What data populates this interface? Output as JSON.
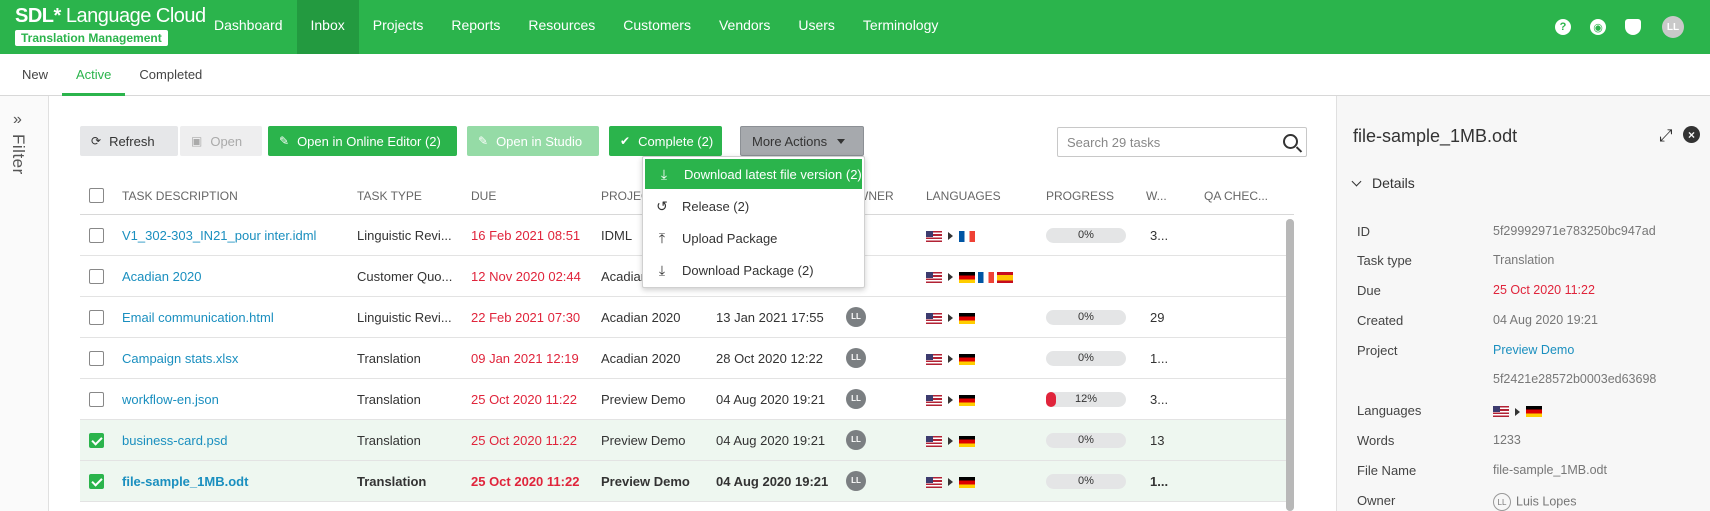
{
  "app": {
    "logo_brand": "SDL",
    "logo_star": "*",
    "logo_product": " Language Cloud",
    "logo_sub": "Translation Management"
  },
  "nav": {
    "items": [
      "Dashboard",
      "Inbox",
      "Projects",
      "Reports",
      "Resources",
      "Customers",
      "Vendors",
      "Users",
      "Terminology"
    ],
    "active": "Inbox"
  },
  "top_icons": {
    "help": "?",
    "globe": "◉",
    "notifications": "🔔",
    "avatar": "LL"
  },
  "subtabs": {
    "items": [
      "New",
      "Active",
      "Completed"
    ],
    "active": "Active"
  },
  "filter": {
    "label": "Filter",
    "chevron": "»"
  },
  "toolbar": {
    "refresh": "Refresh",
    "open": "Open",
    "open_online_editor": "Open in Online Editor (2)",
    "open_studio": "Open in Studio",
    "complete": "Complete (2)",
    "more_actions": "More Actions"
  },
  "search": {
    "placeholder": "Search 29 tasks"
  },
  "more_actions_menu": [
    {
      "label": "Download latest file version (2)",
      "icon": "download-icon"
    },
    {
      "label": "Release (2)",
      "icon": "undo-icon"
    },
    {
      "label": "Upload Package",
      "icon": "upload-icon"
    },
    {
      "label": "Download Package (2)",
      "icon": "download-icon"
    }
  ],
  "table": {
    "headers": {
      "description": "TASK DESCRIPTION",
      "type": "TASK TYPE",
      "due": "DUE",
      "project": "PROJEC",
      "owner": "WNER",
      "languages": "LANGUAGES",
      "progress": "PROGRESS",
      "words": "W...",
      "qa": "QA CHEC..."
    },
    "rows": [
      {
        "description": "V1_302-303_IN21_pour inter.idml",
        "type": "Linguistic Revi...",
        "due": "16 Feb 2021 08:51",
        "project": "IDML",
        "created": "",
        "owner": "",
        "targets": [
          "fr"
        ],
        "progress": "0%",
        "progress_value": 0,
        "words": "3...",
        "selected": false,
        "current": false
      },
      {
        "description": "Acadian 2020",
        "type": "Customer Quo...",
        "due": "12 Nov 2020 02:44",
        "project": "Acadian",
        "created": "",
        "owner": "",
        "targets": [
          "de",
          "fr",
          "es"
        ],
        "progress": "",
        "progress_value": null,
        "words": "",
        "selected": false,
        "current": false
      },
      {
        "description": "Email communication.html",
        "type": "Linguistic Revi...",
        "due": "22 Feb 2021 07:30",
        "project": "Acadian 2020",
        "created": "13 Jan 2021 17:55",
        "owner": "LL",
        "targets": [
          "de"
        ],
        "progress": "0%",
        "progress_value": 0,
        "words": "29",
        "selected": false,
        "current": false
      },
      {
        "description": "Campaign stats.xlsx",
        "type": "Translation",
        "due": "09 Jan 2021 12:19",
        "project": "Acadian 2020",
        "created": "28 Oct 2020 12:22",
        "owner": "LL",
        "targets": [
          "de"
        ],
        "progress": "0%",
        "progress_value": 0,
        "words": "1...",
        "selected": false,
        "current": false
      },
      {
        "description": "workflow-en.json",
        "type": "Translation",
        "due": "25 Oct 2020 11:22",
        "project": "Preview Demo",
        "created": "04 Aug 2020 19:21",
        "owner": "LL",
        "targets": [
          "de"
        ],
        "progress": "12%",
        "progress_value": 12,
        "words": "3...",
        "selected": false,
        "current": false
      },
      {
        "description": "business-card.psd",
        "type": "Translation",
        "due": "25 Oct 2020 11:22",
        "project": "Preview Demo",
        "created": "04 Aug 2020 19:21",
        "owner": "LL",
        "targets": [
          "de"
        ],
        "progress": "0%",
        "progress_value": 0,
        "words": "13",
        "selected": true,
        "current": false
      },
      {
        "description": "file-sample_1MB.odt",
        "type": "Translation",
        "due": "25 Oct 2020 11:22",
        "project": "Preview Demo",
        "created": "04 Aug 2020 19:21",
        "owner": "LL",
        "targets": [
          "de"
        ],
        "progress": "0%",
        "progress_value": 0,
        "words": "1...",
        "selected": true,
        "current": true
      }
    ]
  },
  "details": {
    "title": "file-sample_1MB.odt",
    "section": "Details",
    "fields": [
      {
        "label": "ID",
        "value": "5f29992971e783250bc947ad",
        "style": ""
      },
      {
        "label": "Task type",
        "value": "Translation",
        "style": ""
      },
      {
        "label": "Due",
        "value": "25 Oct 2020 11:22",
        "style": "red"
      },
      {
        "label": "Created",
        "value": "04 Aug 2020 19:21",
        "style": ""
      },
      {
        "label": "Project",
        "value": "Preview Demo",
        "style": "link"
      },
      {
        "label": "",
        "value": "5f2421e28572b0003ed63698",
        "style": ""
      },
      {
        "label": "Languages",
        "value": "",
        "style": "flags"
      },
      {
        "label": "Words",
        "value": "1233",
        "style": ""
      },
      {
        "label": "File Name",
        "value": "file-sample_1MB.odt",
        "style": ""
      },
      {
        "label": "Owner",
        "value": "Luis Lopes",
        "style": "owner",
        "initials": "LL"
      }
    ]
  },
  "colors": {
    "brand_green": "#2bb44c",
    "due_red": "#e0243b",
    "link_blue": "#1a8fbf"
  }
}
